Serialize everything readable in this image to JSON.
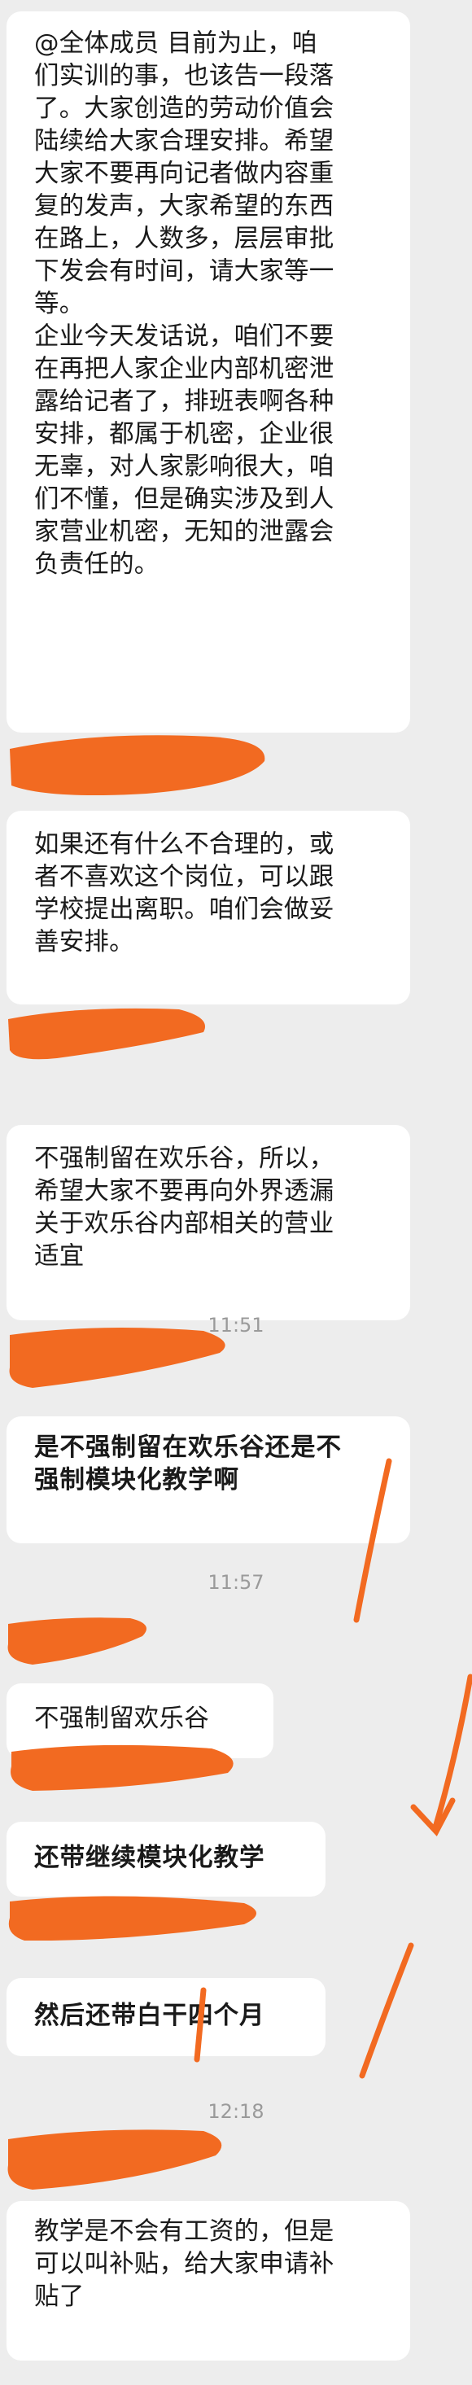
{
  "messages": [
    "@全体成员 目前为止，咱\n们实训的事，也该告一段落\n了。大家创造的劳动价值会\n陆续给大家合理安排。希望\n大家不要再向记者做内容重\n复的发声，大家希望的东西\n在路上，人数多，层层审批\n下发会有时间，请大家等一\n等。\n企业今天发话说，咱们不要\n在再把人家企业内部机密泄\n露给记者了，排班表啊各种\n安排，都属于机密，企业很\n无辜，对人家影响很大，咱\n们不懂，但是确实涉及到人\n家营业机密，无知的泄露会\n负责任的。",
    "如果还有什么不合理的，或\n者不喜欢这个岗位，可以跟\n学校提出离职。咱们会做妥\n善安排。",
    "不强制留在欢乐谷，所以，\n希望大家不要再向外界透漏\n关于欢乐谷内部相关的营业\n适宜",
    "是不强制留在欢乐谷还是不\n强制模块化教学啊",
    "不强制留欢乐谷",
    "还带继续模块化教学",
    "然后还带白干四个月",
    "教学是不会有工资的，但是\n可以叫补贴，给大家申请补\n贴了"
  ],
  "timestamps": [
    "11:51",
    "11:57",
    "12:18"
  ],
  "colors": {
    "background": "#ededed",
    "bubble": "#ffffff",
    "text": "#1a1a1a",
    "timestamp": "#9a9a9a",
    "redaction": "#f26a21"
  }
}
